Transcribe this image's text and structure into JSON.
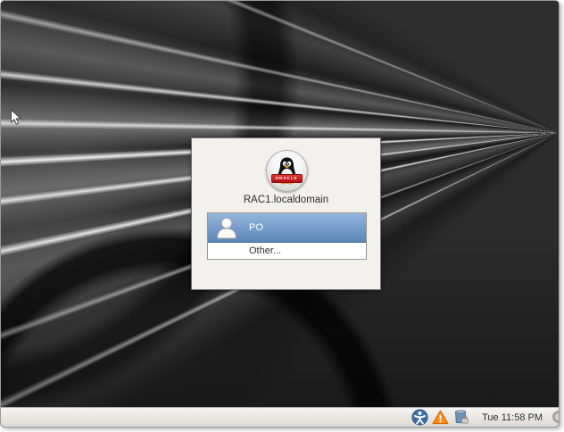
{
  "login_dialog": {
    "hostname": "RAC1.localdomain",
    "logo_icon": "tux-penguin-oracle-logo",
    "logo_badge_text": "ORACLE",
    "logo_badge_color": "#bb1111",
    "user_list": [
      {
        "label": "PO",
        "selected": true,
        "icon": "user-avatar-icon"
      }
    ],
    "other_option": "Other...",
    "selection_color_top": "#93b6dc",
    "selection_color_bottom": "#5c86b9",
    "dialog_background": "#f2f1ee"
  },
  "taskbar": {
    "clock": "Tue 11:58 PM",
    "background_color": "#e9e6e1",
    "icons": [
      {
        "name": "accessibility-icon",
        "color": "#3c6ea5"
      },
      {
        "name": "warning-icon",
        "color": "#f57900"
      },
      {
        "name": "shutdown-lock-icon",
        "color": "#6d93bd"
      }
    ]
  },
  "desktop": {
    "wallpaper_base_color": "#232323",
    "cursor": "arrow-cursor"
  }
}
